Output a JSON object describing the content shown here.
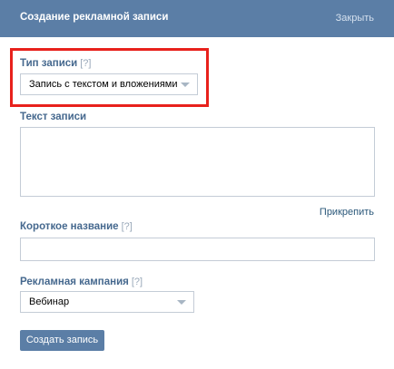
{
  "header": {
    "title": "Создание рекламной записи",
    "close_label": "Закрыть"
  },
  "post_type": {
    "label": "Тип записи",
    "help": "[?]",
    "selected": "Запись с текстом и вложениями"
  },
  "post_text": {
    "label": "Текст записи",
    "value": "",
    "attach_label": "Прикрепить"
  },
  "short_name": {
    "label": "Короткое название",
    "help": "[?]",
    "value": ""
  },
  "campaign": {
    "label": "Рекламная кампания",
    "help": "[?]",
    "selected": "Вебинар"
  },
  "submit": {
    "label": "Создать запись"
  },
  "colors": {
    "header_bg": "#5b7ea6",
    "label": "#45688e",
    "highlight": "#e8211c"
  }
}
